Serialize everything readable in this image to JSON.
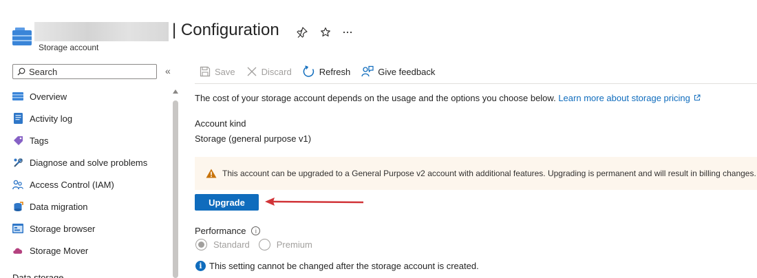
{
  "header": {
    "title": "| Configuration",
    "subtitle": "Storage account",
    "icons": [
      "storage-account-icon",
      "pin-icon",
      "star-icon",
      "more-icon"
    ]
  },
  "sidebar": {
    "search_placeholder": "Search",
    "items": [
      {
        "label": "Overview",
        "icon": "overview-icon"
      },
      {
        "label": "Activity log",
        "icon": "activity-log-icon"
      },
      {
        "label": "Tags",
        "icon": "tag-icon"
      },
      {
        "label": "Diagnose and solve problems",
        "icon": "wrench-icon"
      },
      {
        "label": "Access Control (IAM)",
        "icon": "people-icon"
      },
      {
        "label": "Data migration",
        "icon": "data-migration-icon"
      },
      {
        "label": "Storage browser",
        "icon": "storage-browser-icon"
      },
      {
        "label": "Storage Mover",
        "icon": "cloud-icon"
      }
    ],
    "section": "Data storage"
  },
  "toolbar": {
    "save": "Save",
    "discard": "Discard",
    "refresh": "Refresh",
    "feedback": "Give feedback"
  },
  "content": {
    "description": "The cost of your storage account depends on the usage and the options you choose below.",
    "learn_more": "Learn more about storage pricing",
    "account_kind_label": "Account kind",
    "account_kind_value": "Storage (general purpose v1)",
    "warning": "This account can be upgraded to a General Purpose v2 account with additional features. Upgrading is permanent and will result in billing changes.",
    "upgrade_button": "Upgrade",
    "performance_label": "Performance",
    "performance_options": [
      "Standard",
      "Premium"
    ],
    "performance_selected": "Standard",
    "note": "This setting cannot be changed after the storage account is created."
  },
  "colors": {
    "accent": "#0f6cbd",
    "warning_bg": "#fdf6ed",
    "warning_icon": "#c8730a",
    "annotation_arrow": "#d13438"
  }
}
